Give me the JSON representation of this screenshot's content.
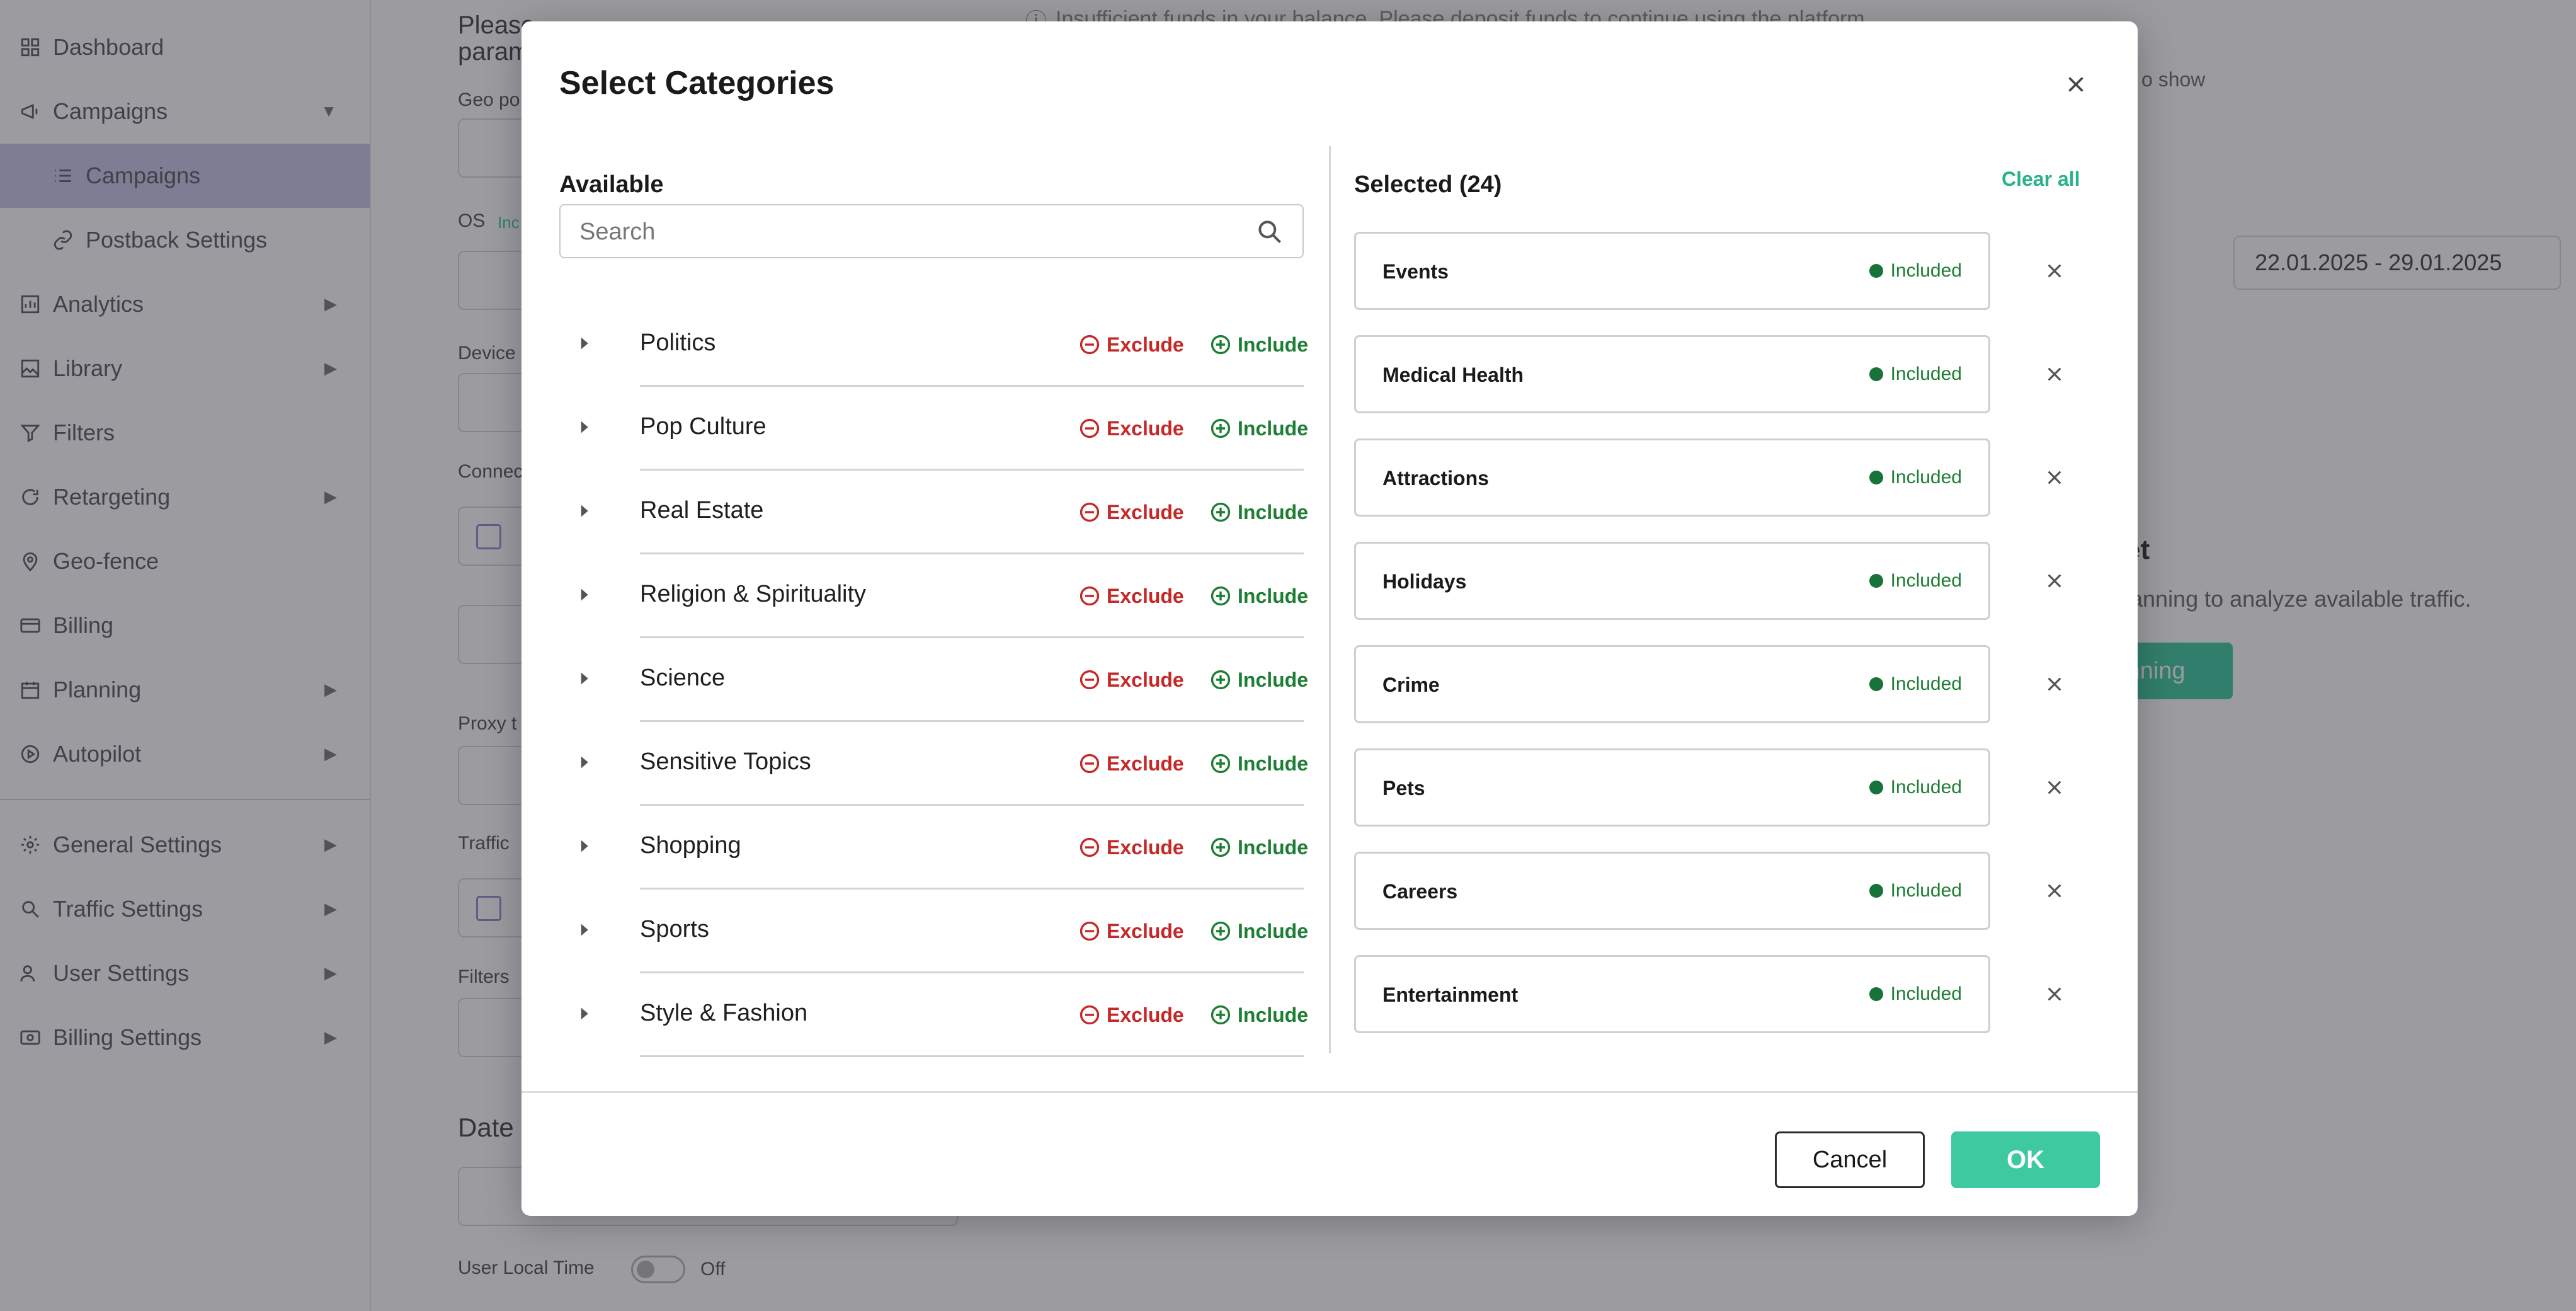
{
  "sidebar": {
    "items": [
      {
        "label": "Dashboard",
        "icon": "dashboard-icon"
      },
      {
        "label": "Campaigns",
        "icon": "megaphone-icon"
      },
      {
        "label": "Campaigns",
        "icon": "list-icon"
      },
      {
        "label": "Postback Settings",
        "icon": "link-icon"
      },
      {
        "label": "Analytics",
        "icon": "chart-icon"
      },
      {
        "label": "Library",
        "icon": "image-icon"
      },
      {
        "label": "Filters",
        "icon": "filter-icon"
      },
      {
        "label": "Retargeting",
        "icon": "refresh-icon"
      },
      {
        "label": "Geo-fence",
        "icon": "pin-icon"
      },
      {
        "label": "Billing",
        "icon": "card-icon"
      },
      {
        "label": "Planning",
        "icon": "calendar-icon"
      },
      {
        "label": "Autopilot",
        "icon": "play-icon"
      },
      {
        "label": "General Settings",
        "icon": "gear-icon"
      },
      {
        "label": "Traffic Settings",
        "icon": "traffic-icon"
      },
      {
        "label": "User Settings",
        "icon": "users-icon"
      },
      {
        "label": "Billing Settings",
        "icon": "billing-icon"
      }
    ]
  },
  "background": {
    "form_intro": "Please",
    "form_intro2": "param",
    "geo_label": "Geo po",
    "os_label": "OS",
    "os_hint": "Inc",
    "device_label": "Device",
    "connection_label": "Connec",
    "proxy_label": "Proxy t",
    "traffic_label": "Traffic",
    "filters_label": "Filters",
    "date_label": "Date",
    "user_local_time_label": "User Local Time",
    "toggle_state": "Off",
    "alert_text": "Insufficient funds in your balance. Please deposit funds to continue using the platform.",
    "right_hint": "o show",
    "date_range": "22.01.2025 - 29.01.2025",
    "panel_heading_fragment": "et",
    "panel_text_fragment": "lanning to analyze available traffic.",
    "panel_button_fragment": "anning"
  },
  "modal": {
    "title": "Select Categories",
    "available_title": "Available",
    "search_placeholder": "Search",
    "exclude_label": "Exclude",
    "include_label": "Include",
    "available_categories": [
      "Politics",
      "Pop Culture",
      "Real Estate",
      "Religion & Spirituality",
      "Science",
      "Sensitive Topics",
      "Shopping",
      "Sports",
      "Style & Fashion"
    ],
    "selected_title": "Selected (24)",
    "clear_all_label": "Clear all",
    "selected_status": "Included",
    "selected_items": [
      "Events",
      "Medical Health",
      "Attractions",
      "Holidays",
      "Crime",
      "Pets",
      "Careers",
      "Entertainment"
    ],
    "cancel_label": "Cancel",
    "ok_label": "OK"
  },
  "colors": {
    "exclude": "#c62828",
    "include": "#1e7e34",
    "accent": "#3ec9a0",
    "overlay": "#23232d"
  }
}
